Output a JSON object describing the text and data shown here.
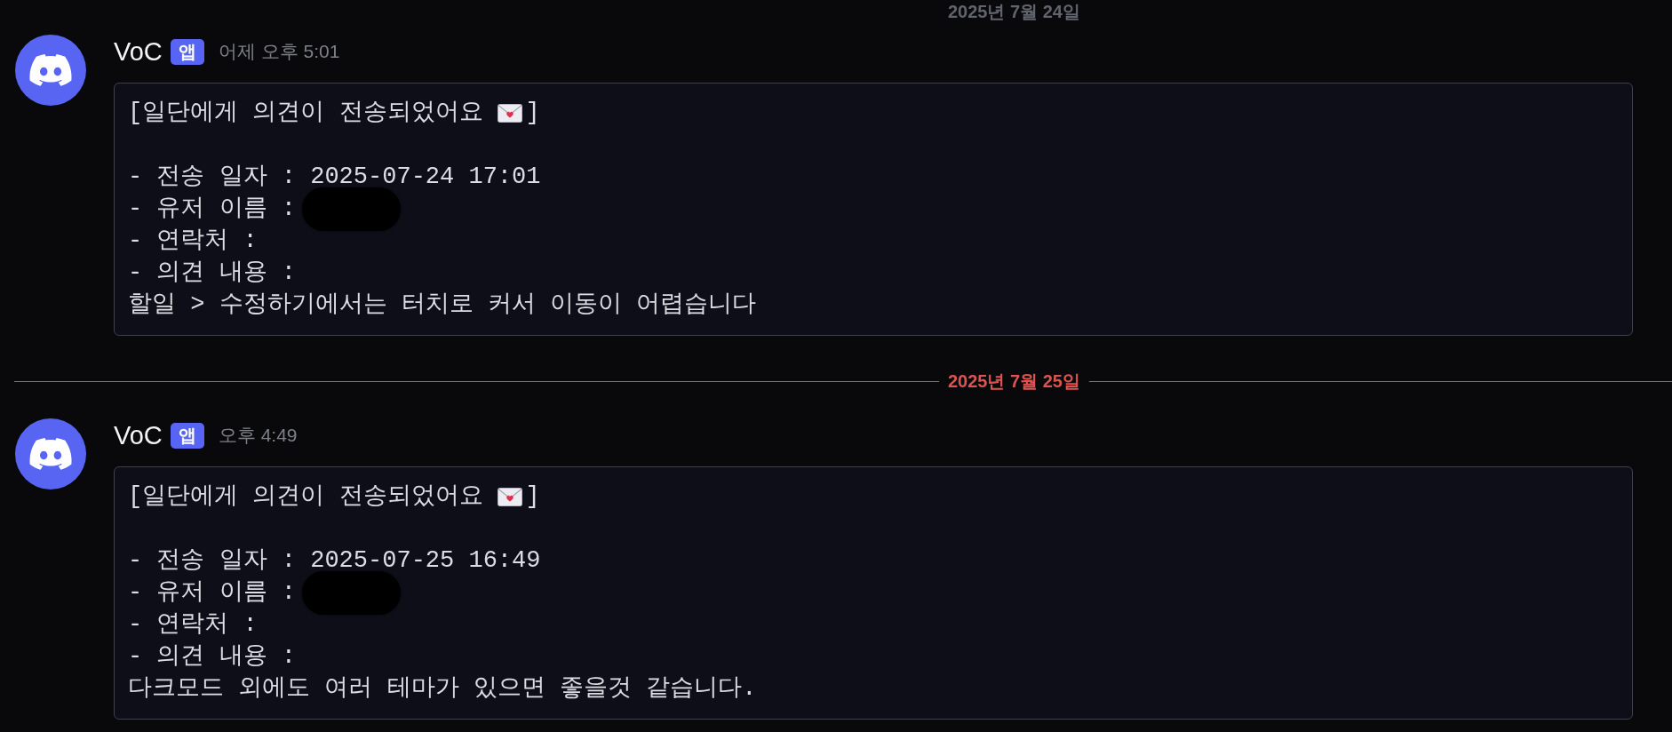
{
  "feed": [
    {
      "kind": "divider",
      "label": "2025년 7월 24일",
      "new": false
    },
    {
      "kind": "message",
      "author": "VoC",
      "badge": "앱",
      "timestamp": "어제 오후 5:01",
      "lines": [
        {
          "kind": "title",
          "text": "[일단에게 의견이 전송되었어요",
          "closing": "]"
        },
        {
          "kind": "text",
          "text": "- 전송 일자 : 2025-07-24 17:01",
          "redacted": false
        },
        {
          "kind": "text",
          "text": "- 유저 이름 :",
          "redacted": true
        },
        {
          "kind": "text",
          "text": "- 연락처 :",
          "redacted": false
        },
        {
          "kind": "text",
          "text": "- 의견 내용 :",
          "redacted": false
        },
        {
          "kind": "text",
          "text": "할일 > 수정하기에서는 터치로 커서 이동이 어렵습니다",
          "redacted": false
        }
      ]
    },
    {
      "kind": "divider",
      "label": "2025년 7월 25일",
      "new": true
    },
    {
      "kind": "message",
      "author": "VoC",
      "badge": "앱",
      "timestamp": "오후 4:49",
      "lines": [
        {
          "kind": "title",
          "text": "[일단에게 의견이 전송되었어요",
          "closing": "]"
        },
        {
          "kind": "text",
          "text": "- 전송 일자 : 2025-07-25 16:49",
          "redacted": false
        },
        {
          "kind": "text",
          "text": "- 유저 이름 :",
          "redacted": true
        },
        {
          "kind": "text",
          "text": "- 연락처 :",
          "redacted": false
        },
        {
          "kind": "text",
          "text": "- 의견 내용 :",
          "redacted": false
        },
        {
          "kind": "text",
          "text": "다크모드 외에도 여러 테마가 있으면 좋을것 같습니다.",
          "redacted": false
        }
      ]
    }
  ]
}
